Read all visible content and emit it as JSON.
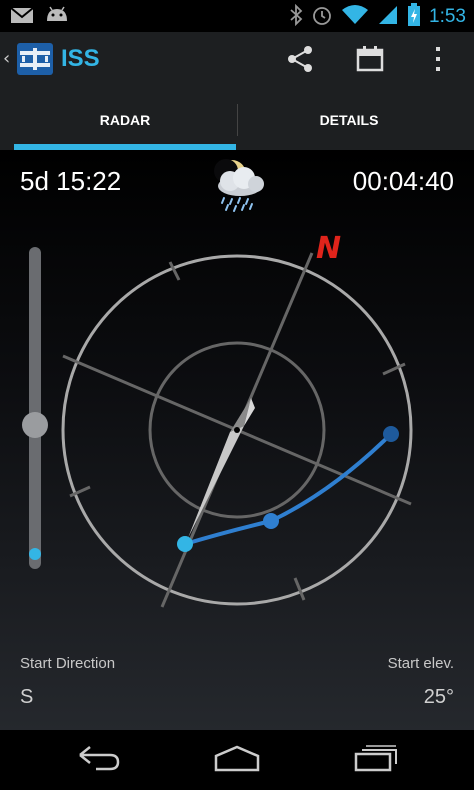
{
  "status_bar": {
    "time": "1:53",
    "icons": [
      "gmail-icon",
      "android-icon",
      "bluetooth-icon",
      "alarm-icon",
      "wifi-icon",
      "signal-icon",
      "battery-icon"
    ]
  },
  "action_bar": {
    "title": "ISS",
    "actions": [
      "share-icon",
      "calendar-icon",
      "overflow-menu-icon"
    ]
  },
  "tabs": [
    {
      "label": "RADAR",
      "selected": true
    },
    {
      "label": "DETAILS",
      "selected": false
    }
  ],
  "pass": {
    "countdown": "5d 15:22",
    "duration": "00:04:40",
    "weather_icon": "rain-cloud-moon-icon"
  },
  "radar": {
    "north_label": "N"
  },
  "footer": {
    "start_direction_label": "Start Direction",
    "start_direction_value": "S",
    "start_elev_label": "Start elev.",
    "start_elev_value": "25°"
  },
  "colors": {
    "accent": "#33b5e5",
    "north": "#e0241b",
    "track": "#2f7fd0"
  }
}
